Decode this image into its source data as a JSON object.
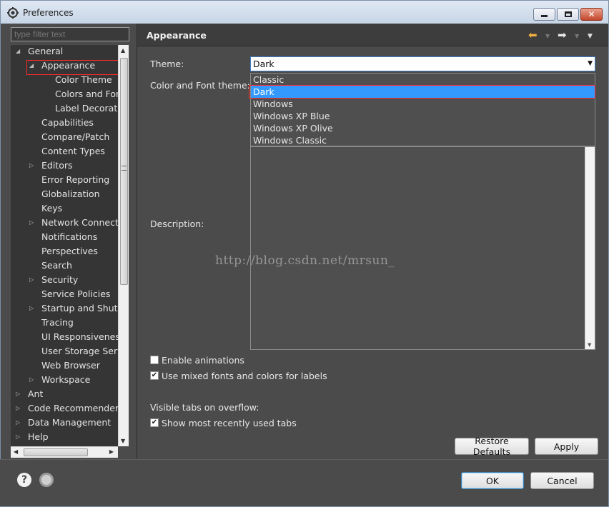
{
  "window": {
    "title": "Preferences",
    "minimize_icon": "minimize-icon",
    "maximize_icon": "maximize-icon",
    "close_icon": "close-icon"
  },
  "filter": {
    "placeholder": "type filter text"
  },
  "tree": {
    "items": [
      {
        "label": "General",
        "level": 0,
        "expander": "expanded"
      },
      {
        "label": "Appearance",
        "level": 1,
        "expander": "expanded",
        "selected": true
      },
      {
        "label": "Color Theme",
        "level": 2,
        "expander": "none"
      },
      {
        "label": "Colors and Fonts",
        "level": 2,
        "expander": "none"
      },
      {
        "label": "Label Decorations",
        "level": 2,
        "expander": "none"
      },
      {
        "label": "Capabilities",
        "level": 1,
        "expander": "none"
      },
      {
        "label": "Compare/Patch",
        "level": 1,
        "expander": "none"
      },
      {
        "label": "Content Types",
        "level": 1,
        "expander": "none"
      },
      {
        "label": "Editors",
        "level": 1,
        "expander": "collapsed"
      },
      {
        "label": "Error Reporting",
        "level": 1,
        "expander": "none"
      },
      {
        "label": "Globalization",
        "level": 1,
        "expander": "none"
      },
      {
        "label": "Keys",
        "level": 1,
        "expander": "none"
      },
      {
        "label": "Network Connections",
        "level": 1,
        "expander": "collapsed"
      },
      {
        "label": "Notifications",
        "level": 1,
        "expander": "none"
      },
      {
        "label": "Perspectives",
        "level": 1,
        "expander": "none"
      },
      {
        "label": "Search",
        "level": 1,
        "expander": "none"
      },
      {
        "label": "Security",
        "level": 1,
        "expander": "collapsed"
      },
      {
        "label": "Service Policies",
        "level": 1,
        "expander": "none"
      },
      {
        "label": "Startup and Shutdown",
        "level": 1,
        "expander": "collapsed"
      },
      {
        "label": "Tracing",
        "level": 1,
        "expander": "none"
      },
      {
        "label": "UI Responsiveness",
        "level": 1,
        "expander": "none"
      },
      {
        "label": "User Storage Service",
        "level": 1,
        "expander": "none"
      },
      {
        "label": "Web Browser",
        "level": 1,
        "expander": "none"
      },
      {
        "label": "Workspace",
        "level": 1,
        "expander": "collapsed"
      },
      {
        "label": "Ant",
        "level": 0,
        "expander": "collapsed"
      },
      {
        "label": "Code Recommenders",
        "level": 0,
        "expander": "collapsed"
      },
      {
        "label": "Data Management",
        "level": 0,
        "expander": "collapsed"
      },
      {
        "label": "Help",
        "level": 0,
        "expander": "collapsed"
      }
    ]
  },
  "page": {
    "title": "Appearance",
    "back_icon": "back-arrow-icon",
    "forward_icon": "forward-arrow-icon",
    "menu_icon": "view-menu-icon"
  },
  "theme": {
    "label": "Theme:",
    "value": "Dark",
    "options": [
      "Classic",
      "Dark",
      "Windows",
      "Windows XP Blue",
      "Windows XP Olive",
      "Windows Classic"
    ],
    "selected_index": 1
  },
  "color_font_theme": {
    "label": "Color and Font theme:"
  },
  "description": {
    "label": "Description:"
  },
  "options": {
    "enable_animations": {
      "label": "Enable animations",
      "checked": false
    },
    "mixed_fonts": {
      "label": "Use mixed fonts and colors for labels",
      "checked": true
    }
  },
  "visible_tabs": {
    "label": "Visible tabs on overflow:",
    "show_recent": {
      "label": "Show most recently used tabs",
      "checked": true
    }
  },
  "watermark": "http://blog.csdn.net/mrsun_",
  "buttons": {
    "restore_defaults": "Restore Defaults",
    "apply": "Apply",
    "ok": "OK",
    "cancel": "Cancel"
  },
  "footer": {
    "help_icon": "help-icon",
    "import_export_icon": "import-export-icon"
  },
  "colors": {
    "background": "#4b4b4b",
    "tree_background": "#353535",
    "selection": "#3399ff",
    "highlight_box": "#ff2a2a",
    "text": "#e8e8e8"
  }
}
